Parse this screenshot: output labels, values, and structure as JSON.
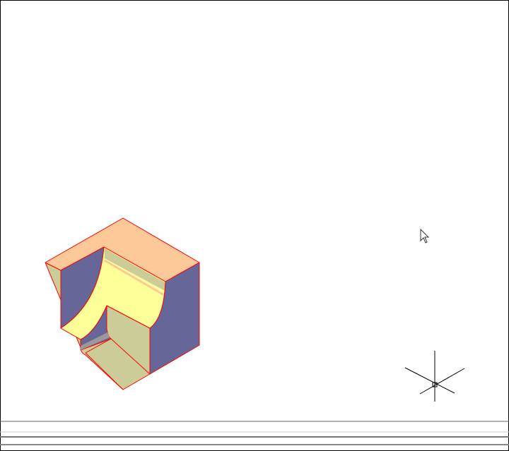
{
  "colors": {
    "top_face": "#fdc898",
    "side_face": "#666699",
    "front_face": "#cccc99",
    "curved_face": "#ffff99",
    "edge": "#ff0000",
    "shadow_strip": "#999999"
  },
  "icons": [
    "mouse-cursor-icon",
    "ucs-compass-icon"
  ]
}
